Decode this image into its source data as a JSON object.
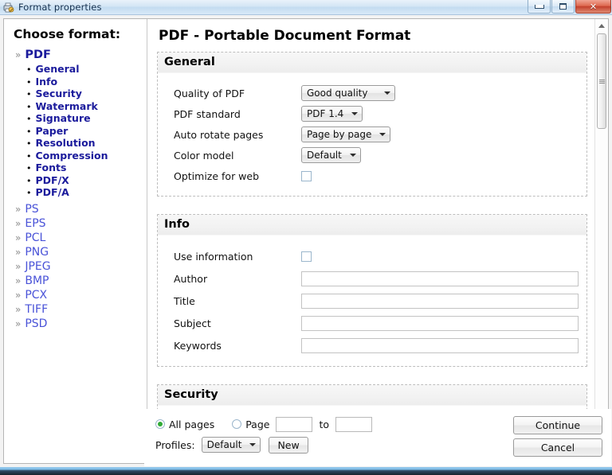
{
  "window": {
    "title": "Format properties",
    "icon": "printer-properties-icon",
    "buttons": {
      "minimize": "minimize-icon",
      "maximize": "maximize-icon",
      "close": "close-icon",
      "close_glyph": "✕"
    }
  },
  "sidebar": {
    "heading": "Choose format:",
    "chevron": "»",
    "bullet": "•",
    "groups": [
      {
        "label": "PDF",
        "active": true,
        "items": [
          "General",
          "Info",
          "Security",
          "Watermark",
          "Signature",
          "Paper",
          "Resolution",
          "Compression",
          "Fonts",
          "PDF/X",
          "PDF/A"
        ]
      },
      {
        "label": "PS",
        "active": false,
        "items": []
      },
      {
        "label": "EPS",
        "active": false,
        "items": []
      },
      {
        "label": "PCL",
        "active": false,
        "items": []
      },
      {
        "label": "PNG",
        "active": false,
        "items": []
      },
      {
        "label": "JPEG",
        "active": false,
        "items": []
      },
      {
        "label": "BMP",
        "active": false,
        "items": []
      },
      {
        "label": "PCX",
        "active": false,
        "items": []
      },
      {
        "label": "TIFF",
        "active": false,
        "items": []
      },
      {
        "label": "PSD",
        "active": false,
        "items": []
      }
    ]
  },
  "main": {
    "title": "PDF - Portable Document Format",
    "sections": {
      "general": {
        "heading": "General",
        "fields": {
          "quality": {
            "label": "Quality of PDF",
            "value": "Good quality"
          },
          "standard": {
            "label": "PDF standard",
            "value": "PDF 1.4"
          },
          "autorotate": {
            "label": "Auto rotate pages",
            "value": "Page by page"
          },
          "colormodel": {
            "label": "Color model",
            "value": "Default"
          },
          "optimize": {
            "label": "Optimize for web",
            "checked": false
          }
        }
      },
      "info": {
        "heading": "Info",
        "fields": {
          "useinfo": {
            "label": "Use information",
            "checked": false
          },
          "author": {
            "label": "Author",
            "value": ""
          },
          "title": {
            "label": "Title",
            "value": ""
          },
          "subject": {
            "label": "Subject",
            "value": ""
          },
          "keywords": {
            "label": "Keywords",
            "value": ""
          }
        }
      },
      "security": {
        "heading": "Security"
      }
    }
  },
  "bottom": {
    "all_pages_label": "All pages",
    "all_pages_selected": true,
    "page_label": "Page",
    "page_from": "",
    "to_label": "to",
    "page_to": "",
    "profiles_label": "Profiles:",
    "profile_value": "Default",
    "new_label": "New",
    "continue_label": "Continue",
    "cancel_label": "Cancel"
  }
}
